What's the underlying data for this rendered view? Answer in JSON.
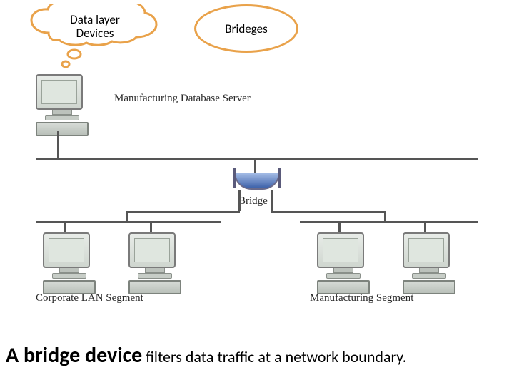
{
  "callout": {
    "line1": "Data layer",
    "line2": "Devices"
  },
  "oval_label": "Brideges",
  "labels": {
    "server": "Manufacturing Database Server",
    "bridge": "Bridge",
    "left_segment": "Corporate LAN Segment",
    "right_segment": "Manufacturing Segment"
  },
  "caption": {
    "bold": "A bridge device",
    "rest": " filters data traffic at a network boundary."
  }
}
